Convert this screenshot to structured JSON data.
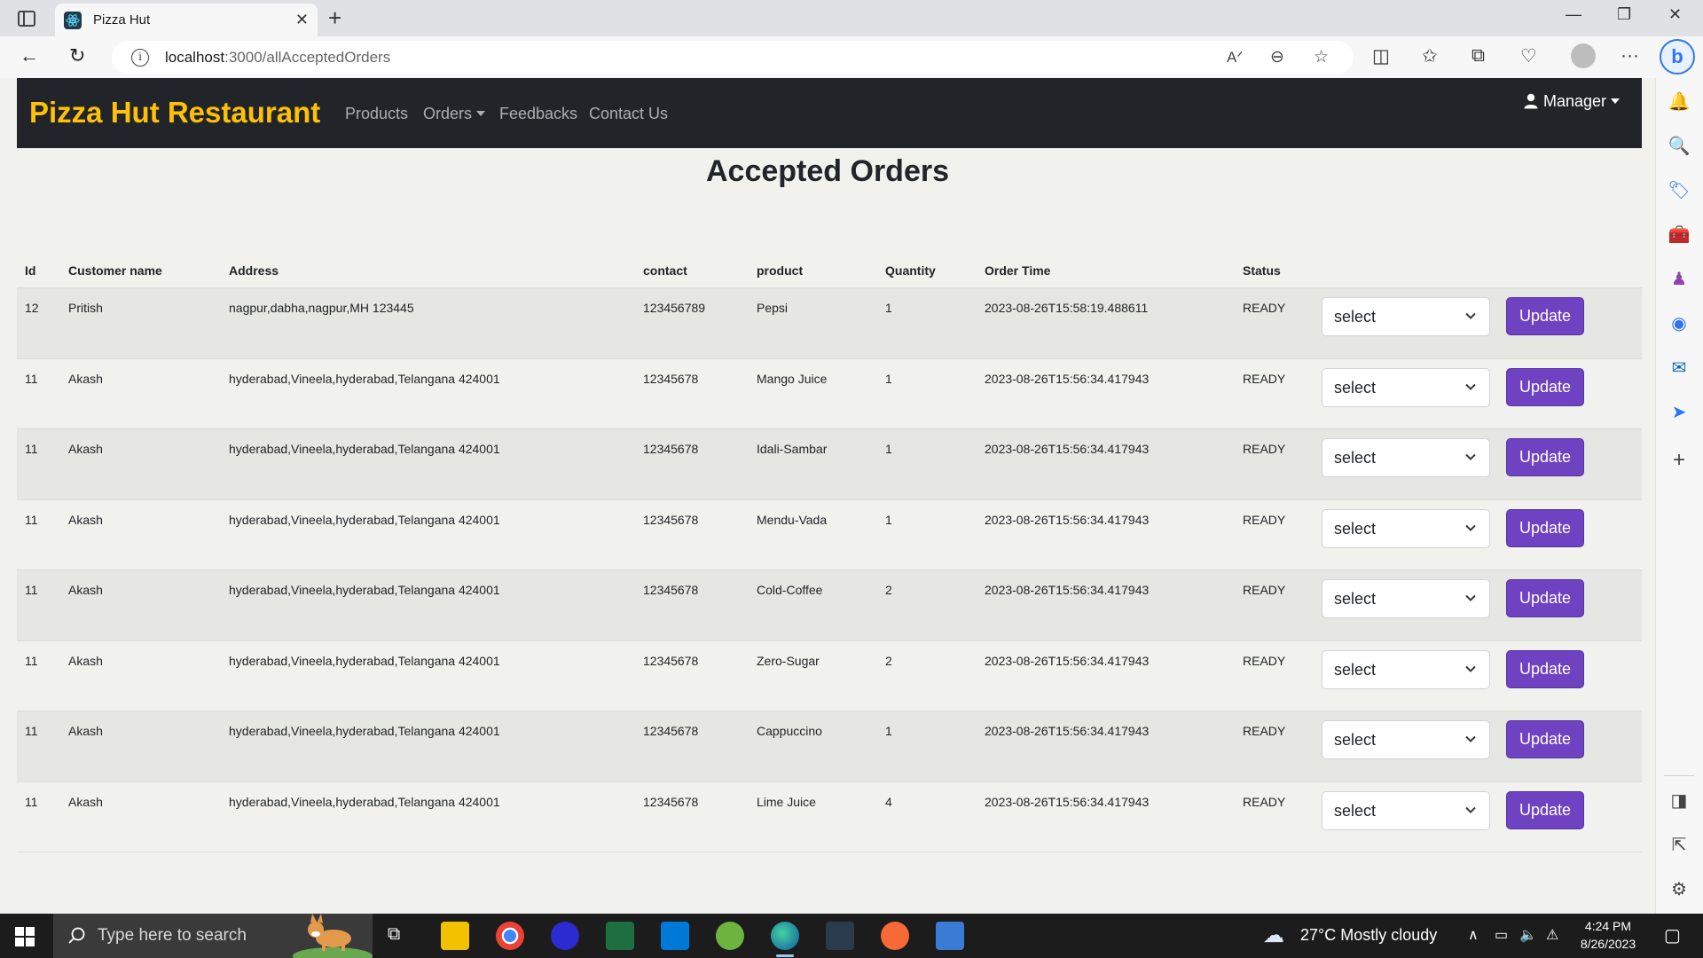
{
  "browser": {
    "tab_title": "Pizza Hut",
    "url_host": "localhost",
    "url_path": ":3000/allAcceptedOrders"
  },
  "navbar": {
    "brand": "Pizza Hut Restaurant",
    "links": [
      "Products",
      "Orders",
      "Feedbacks",
      "Contact Us"
    ],
    "user_menu": "Manager"
  },
  "heading": "Accepted Orders",
  "table": {
    "columns": [
      "Id",
      "Customer name",
      "Address",
      "contact",
      "product",
      "Quantity",
      "Order Time",
      "Status"
    ],
    "rows": [
      {
        "id": "12",
        "customer": "Pritish",
        "address": "nagpur,dabha,nagpur,MH 123445",
        "contact": "123456789",
        "product": "Pepsi",
        "quantity": "1",
        "order_time": "2023-08-26T15:58:19.488611",
        "status": "READY"
      },
      {
        "id": "11",
        "customer": "Akash",
        "address": "hyderabad,Vineela,hyderabad,Telangana 424001",
        "contact": "12345678",
        "product": "Mango Juice",
        "quantity": "1",
        "order_time": "2023-08-26T15:56:34.417943",
        "status": "READY"
      },
      {
        "id": "11",
        "customer": "Akash",
        "address": "hyderabad,Vineela,hyderabad,Telangana 424001",
        "contact": "12345678",
        "product": "Idali-Sambar",
        "quantity": "1",
        "order_time": "2023-08-26T15:56:34.417943",
        "status": "READY"
      },
      {
        "id": "11",
        "customer": "Akash",
        "address": "hyderabad,Vineela,hyderabad,Telangana 424001",
        "contact": "12345678",
        "product": "Mendu-Vada",
        "quantity": "1",
        "order_time": "2023-08-26T15:56:34.417943",
        "status": "READY"
      },
      {
        "id": "11",
        "customer": "Akash",
        "address": "hyderabad,Vineela,hyderabad,Telangana 424001",
        "contact": "12345678",
        "product": "Cold-Coffee",
        "quantity": "2",
        "order_time": "2023-08-26T15:56:34.417943",
        "status": "READY"
      },
      {
        "id": "11",
        "customer": "Akash",
        "address": "hyderabad,Vineela,hyderabad,Telangana 424001",
        "contact": "12345678",
        "product": "Zero-Sugar",
        "quantity": "2",
        "order_time": "2023-08-26T15:56:34.417943",
        "status": "READY"
      },
      {
        "id": "11",
        "customer": "Akash",
        "address": "hyderabad,Vineela,hyderabad,Telangana 424001",
        "contact": "12345678",
        "product": "Cappuccino",
        "quantity": "1",
        "order_time": "2023-08-26T15:56:34.417943",
        "status": "READY"
      },
      {
        "id": "11",
        "customer": "Akash",
        "address": "hyderabad,Vineela,hyderabad,Telangana 424001",
        "contact": "12345678",
        "product": "Lime Juice",
        "quantity": "4",
        "order_time": "2023-08-26T15:56:34.417943",
        "status": "READY"
      }
    ],
    "select_value": "select",
    "update_label": "Update"
  },
  "taskbar": {
    "search_placeholder": "Type here to search",
    "weather": "27°C  Mostly cloudy",
    "time": "4:24 PM",
    "date": "8/26/2023"
  },
  "colors": {
    "navbar_bg": "#212529",
    "brand": "#ffc107",
    "update_button": "#6f42c1"
  }
}
